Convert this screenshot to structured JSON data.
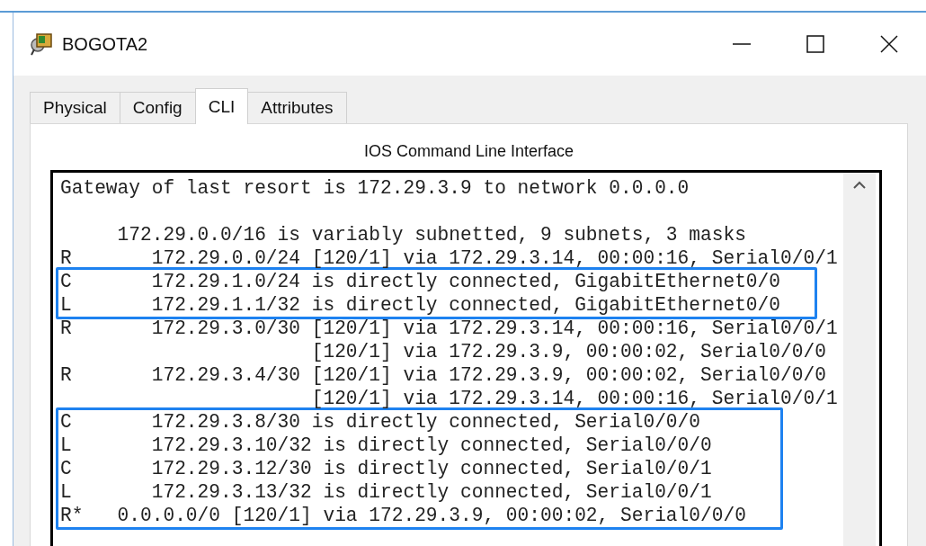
{
  "window": {
    "title": "BOGOTA2"
  },
  "tabs": [
    {
      "label": "Physical",
      "selected": false
    },
    {
      "label": "Config",
      "selected": false
    },
    {
      "label": "CLI",
      "selected": true
    },
    {
      "label": "Attributes",
      "selected": false
    }
  ],
  "panel_title": "IOS Command Line Interface",
  "terminal": {
    "blocks": [
      {
        "highlighted": false,
        "blank_line_after": true,
        "lines": [
          "Gateway of last resort is 172.29.3.9 to network 0.0.0.0"
        ]
      },
      {
        "highlighted": false,
        "lines": [
          "     172.29.0.0/16 is variably subnetted, 9 subnets, 3 masks",
          "R       172.29.0.0/24 [120/1] via 172.29.3.14, 00:00:16, Serial0/0/1"
        ]
      },
      {
        "highlighted": true,
        "lines": [
          "C       172.29.1.0/24 is directly connected, GigabitEthernet0/0",
          "L       172.29.1.1/32 is directly connected, GigabitEthernet0/0"
        ]
      },
      {
        "highlighted": false,
        "lines": [
          "R       172.29.3.0/30 [120/1] via 172.29.3.14, 00:00:16, Serial0/0/1",
          "                      [120/1] via 172.29.3.9, 00:00:02, Serial0/0/0",
          "R       172.29.3.4/30 [120/1] via 172.29.3.9, 00:00:02, Serial0/0/0",
          "                      [120/1] via 172.29.3.14, 00:00:16, Serial0/0/1"
        ]
      },
      {
        "highlighted": true,
        "lines": [
          "C       172.29.3.8/30 is directly connected, Serial0/0/0",
          "L       172.29.3.10/32 is directly connected, Serial0/0/0",
          "C       172.29.3.12/30 is directly connected, Serial0/0/1",
          "L       172.29.3.13/32 is directly connected, Serial0/0/1",
          "R*   0.0.0.0/0 [120/1] via 172.29.3.9, 00:00:02, Serial0/0/0"
        ]
      }
    ]
  }
}
